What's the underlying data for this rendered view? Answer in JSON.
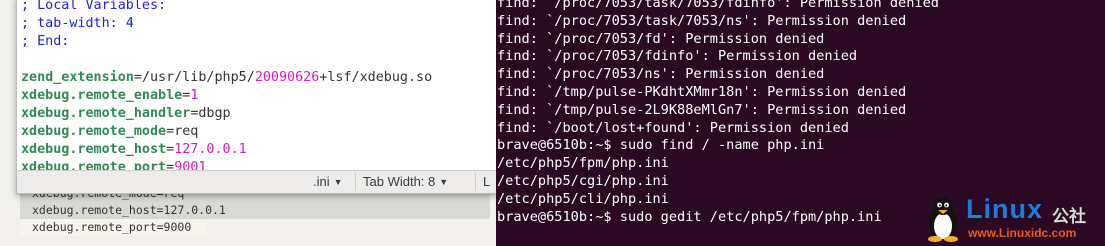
{
  "background_doc": {
    "lines": [
      "xdebug.remote_mode=req",
      "xdebug.remote_host=127.0.0.1",
      "xdebug.remote_port=9000"
    ]
  },
  "editor": {
    "comments": [
      "; Local Variables:",
      "; tab-width: 4",
      "; End:"
    ],
    "zend": {
      "key": "zend_extension",
      "eq": "=",
      "path_pre": "/usr/lib/php5/",
      "path_num": "20090626",
      "path_post": "+lsf/xdebug.so"
    },
    "settings": [
      {
        "key": "xdebug.remote_enable",
        "value": "1",
        "value_color": "num"
      },
      {
        "key": "xdebug.remote_handler",
        "value": "dbgp",
        "value_color": "plain"
      },
      {
        "key": "xdebug.remote_mode",
        "value": "req",
        "value_color": "plain"
      },
      {
        "key": "xdebug.remote_host",
        "value": "127.0.0.1",
        "value_color": "num"
      },
      {
        "key": "xdebug.remote_port",
        "value": "9001",
        "value_color": "num"
      }
    ],
    "status": {
      "language": ".ini",
      "tab_width": "Tab Width: 8",
      "extra": "L"
    }
  },
  "terminal": {
    "lines": [
      "find: `/proc/7053/task/7053/fdinfo': Permission denied",
      "find: `/proc/7053/task/7053/ns': Permission denied",
      "find: `/proc/7053/fd': Permission denied",
      "find: `/proc/7053/fdinfo': Permission denied",
      "find: `/proc/7053/ns': Permission denied",
      "find: `/tmp/pulse-PKdhtXMmr18n': Permission denied",
      "find: `/tmp/pulse-2L9K88eMlGn7': Permission denied",
      "find: `/boot/lost+found': Permission denied",
      "brave@6510b:~$ sudo find / -name php.ini",
      "/etc/php5/fpm/php.ini",
      "/etc/php5/cgi/php.ini",
      "/etc/php5/cli/php.ini",
      "brave@6510b:~$ sudo gedit /etc/php5/fpm/php.ini"
    ]
  },
  "watermark": {
    "brand": "Linux",
    "cn": "公社",
    "url": "www.Linuxidc.com"
  },
  "colors": {
    "terminal_bg": "#2c0922",
    "comment": "#1e1ee6",
    "key": "#2e8b57",
    "number": "#d81bbd",
    "brand": "#1a7de0"
  }
}
